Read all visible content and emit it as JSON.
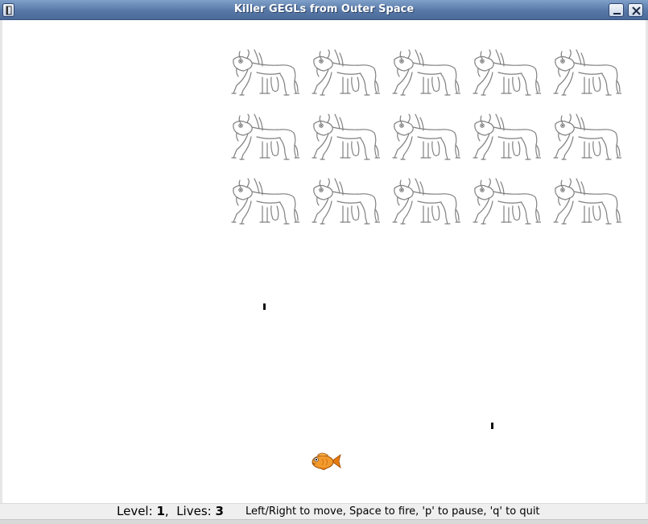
{
  "window": {
    "title": "Killer GEGLs from Outer Space",
    "menu_icon": "window-menu-icon",
    "minimize_icon": "minimize-icon",
    "close_icon": "close-icon"
  },
  "game": {
    "enemy_icon": "goat-icon",
    "player_icon": "goldfish-icon",
    "enemy_rows": 3,
    "enemy_cols": 5,
    "enemy_color": "#808080",
    "player_color": "#f08a1c"
  },
  "status": {
    "level_label": "Level:",
    "level_value": "1",
    "separator": ",",
    "lives_label": "Lives:",
    "lives_value": "3",
    "help_text": "Left/Right to move, Space to fire, 'p' to pause, 'q' to quit"
  }
}
